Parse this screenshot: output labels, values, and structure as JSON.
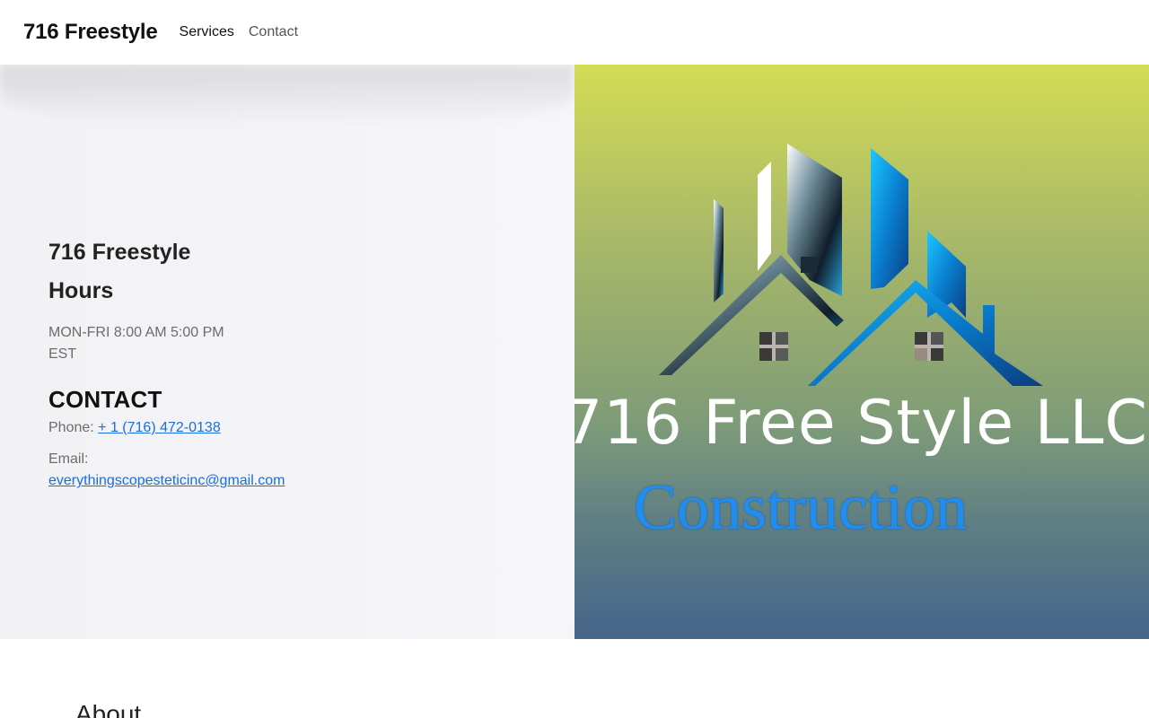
{
  "nav": {
    "brand": "716 Freestyle",
    "links": [
      "Services",
      "Contact"
    ]
  },
  "hero": {
    "business_name": "716 Freestyle",
    "hours_heading": "Hours",
    "hours_line1": "MON-FRI 8:00 AM 5:00 PM",
    "hours_line2": "EST",
    "contact_heading": "CONTACT",
    "phone_label": "Phone:",
    "phone_value": "+ 1 (716) 472-0138",
    "email_label": "Email:",
    "email_value": "everythingscopesteticinc@gmail.com"
  },
  "logo": {
    "title": "716 Free Style LLC",
    "subtitle": "Construction",
    "icon": "house-roof-logo"
  },
  "about": {
    "heading": "About"
  },
  "colors": {
    "link": "#1a6ee0",
    "logo_blue": "#1f8ef0",
    "gradient_top": "#d3dc55",
    "gradient_bottom": "#46658a"
  }
}
